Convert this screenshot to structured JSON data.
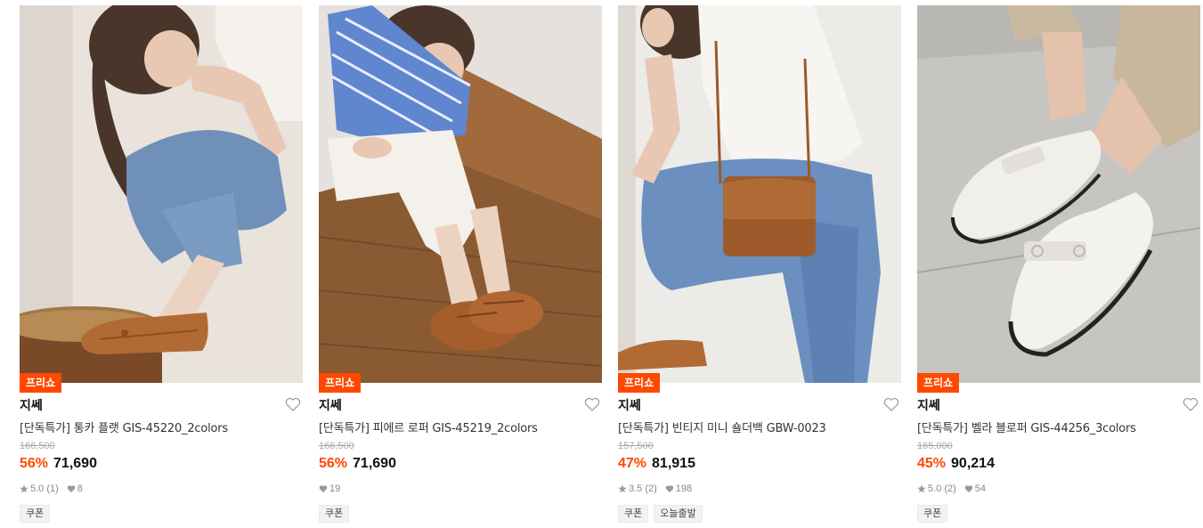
{
  "accent_color": "#ff4800",
  "products": [
    {
      "badge": "프리쇼",
      "brand": "지쎄",
      "title": "[단독특가] 통카 플랫 GIS-45220_2colors",
      "original_price": "166,500",
      "discount": "56%",
      "price": "71,690",
      "rating": "5.0 (1)",
      "likes": "8",
      "tags": [
        "쿠폰"
      ],
      "image_subject": "brown woven loafer on rattan stool"
    },
    {
      "badge": "프리쇼",
      "brand": "지쎄",
      "title": "[단독특가] 피에르 로퍼 GIS-45219_2colors",
      "original_price": "166,500",
      "discount": "56%",
      "price": "71,690",
      "rating": "",
      "likes": "19",
      "tags": [
        "쿠폰"
      ],
      "image_subject": "brown woven lace-up loafers on wooden floor"
    },
    {
      "badge": "프리쇼",
      "brand": "지쎄",
      "title": "[단독특가] 빈티지 미니 숄더백 GBW-0023",
      "original_price": "157,500",
      "discount": "47%",
      "price": "81,915",
      "rating": "3.5 (2)",
      "likes": "198",
      "tags": [
        "쿠폰",
        "오늘출발"
      ],
      "image_subject": "brown mini shoulder bag with jeans"
    },
    {
      "badge": "프리쇼",
      "brand": "지쎄",
      "title": "[단독특가] 벨라 블로퍼 GIS-44256_3colors",
      "original_price": "165,000",
      "discount": "45%",
      "price": "90,214",
      "rating": "5.0 (2)",
      "likes": "54",
      "tags": [
        "쿠폰"
      ],
      "image_subject": "white leather bloafer mules on concrete"
    }
  ]
}
